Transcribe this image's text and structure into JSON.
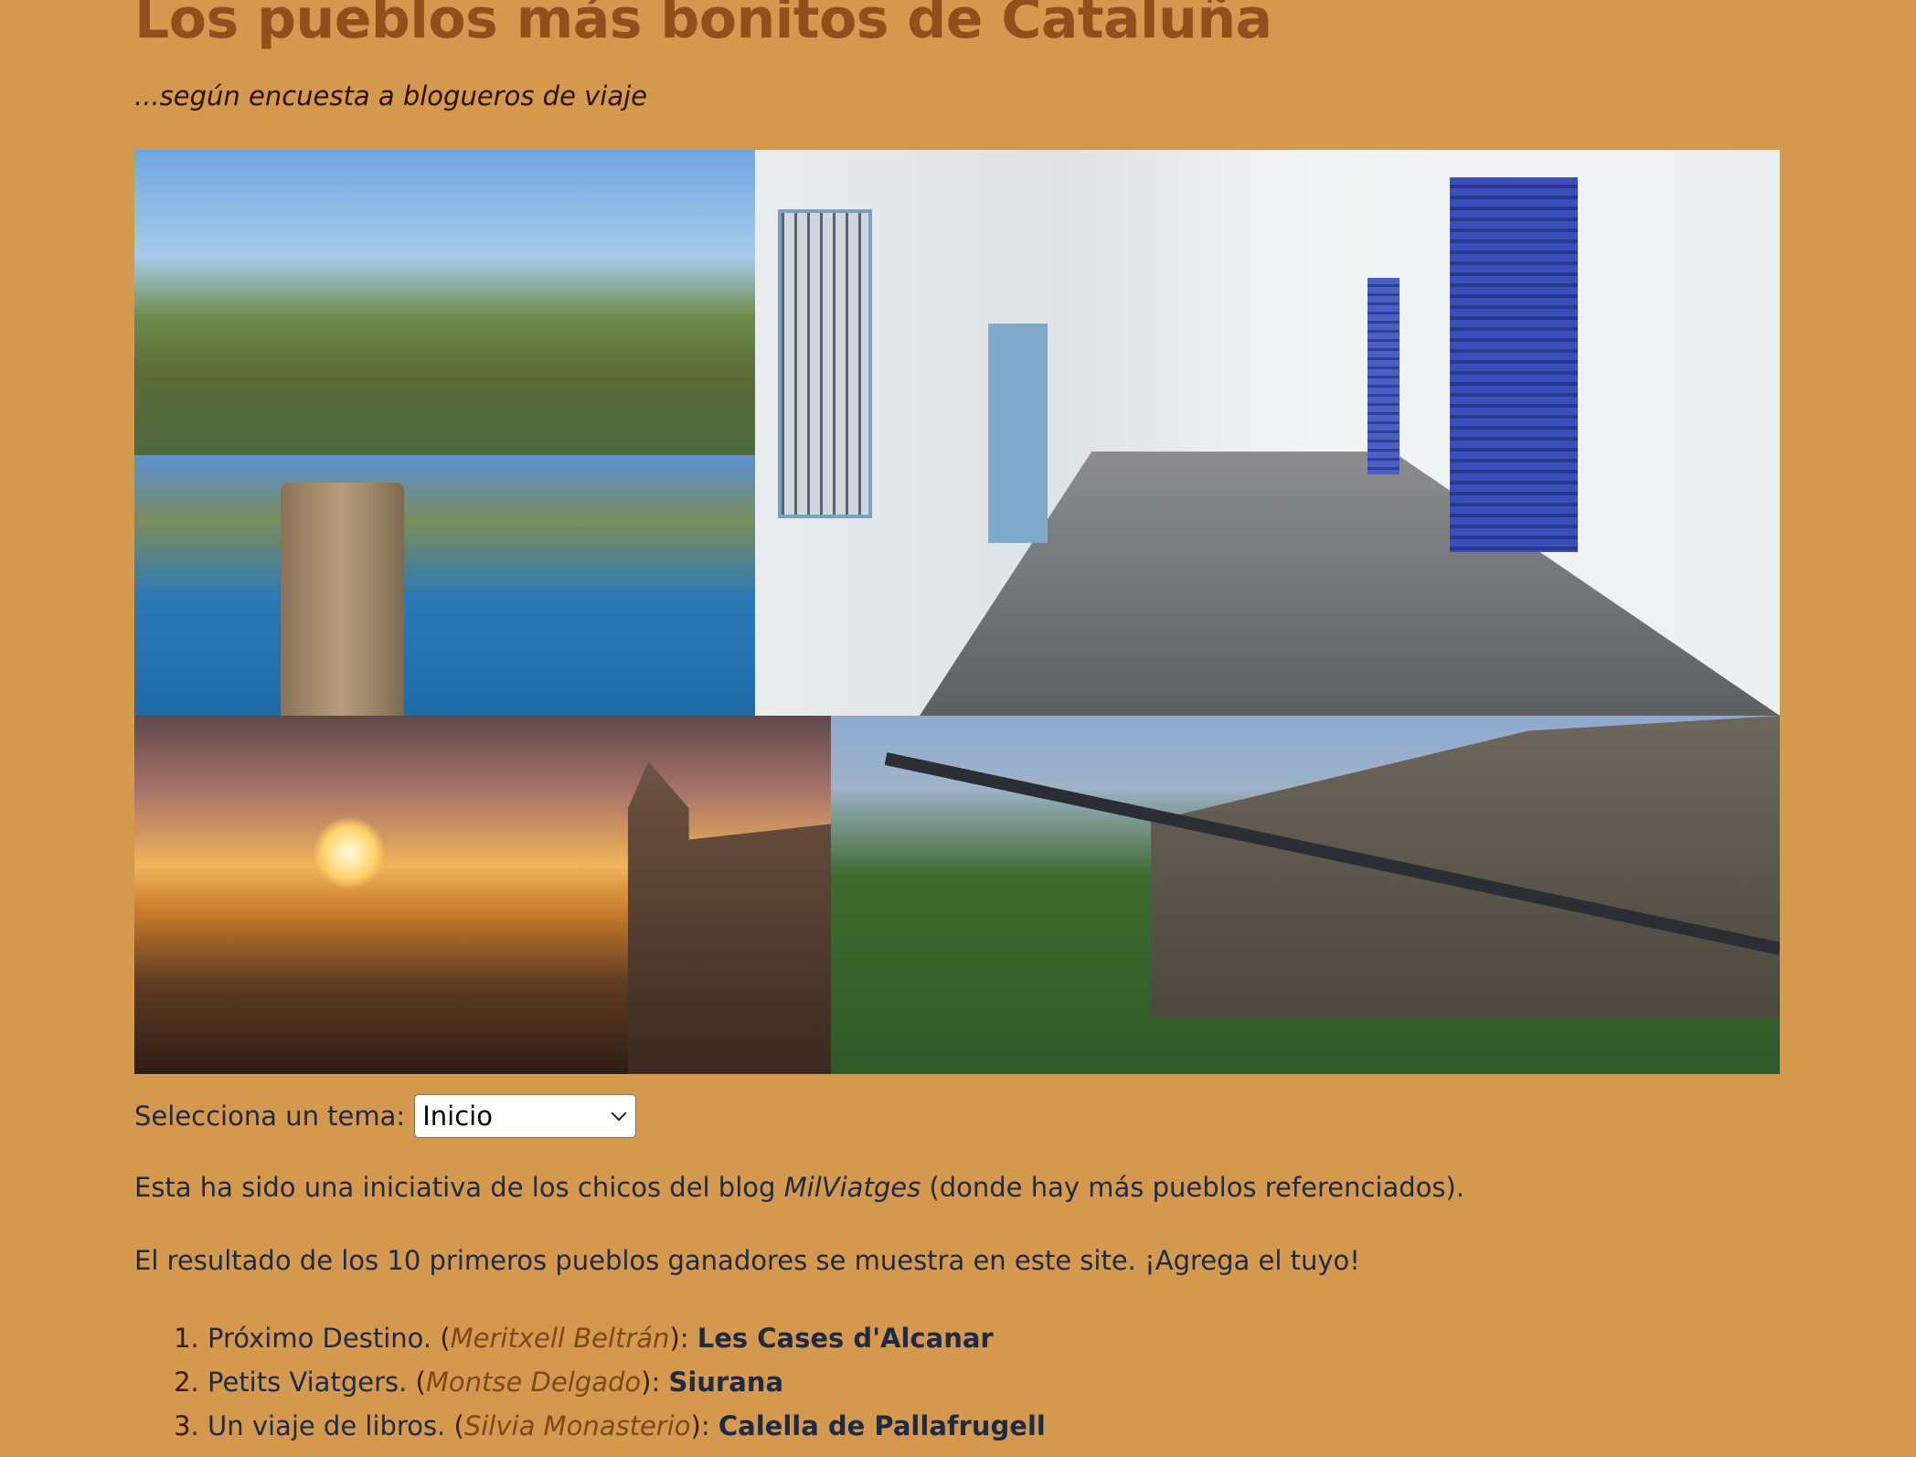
{
  "header": {
    "title": "Los pueblos más bonitos de Cataluña",
    "subtitle": "...según encuesta a blogueros de viaje"
  },
  "colors": {
    "background": "#d4984f",
    "title": "#8e501c",
    "text": "#1f2a44",
    "author": "#7a4a1a"
  },
  "topic_select": {
    "label": "Selecciona un tema:",
    "value": "Inicio"
  },
  "intro": {
    "p1_before": "Esta ha sido una iniciativa de los chicos del blog ",
    "p1_blog": "MilViatges",
    "p1_after": " (donde hay más pueblos referenciados).",
    "p2": "El resultado de los 10 primeros pueblos ganadores se muestra en este site. ¡Agrega el tuyo!"
  },
  "ranking": [
    {
      "blog": "Próximo Destino.",
      "author": "Meritxell Beltrán",
      "town": "Les Cases d'Alcanar"
    },
    {
      "blog": "Petits Viatgers.",
      "author": "Montse Delgado",
      "town": "Siurana"
    },
    {
      "blog": "Un viaje de libros.",
      "author": "Silvia Monasterio",
      "town": "Calella de Pallafrugell"
    }
  ]
}
